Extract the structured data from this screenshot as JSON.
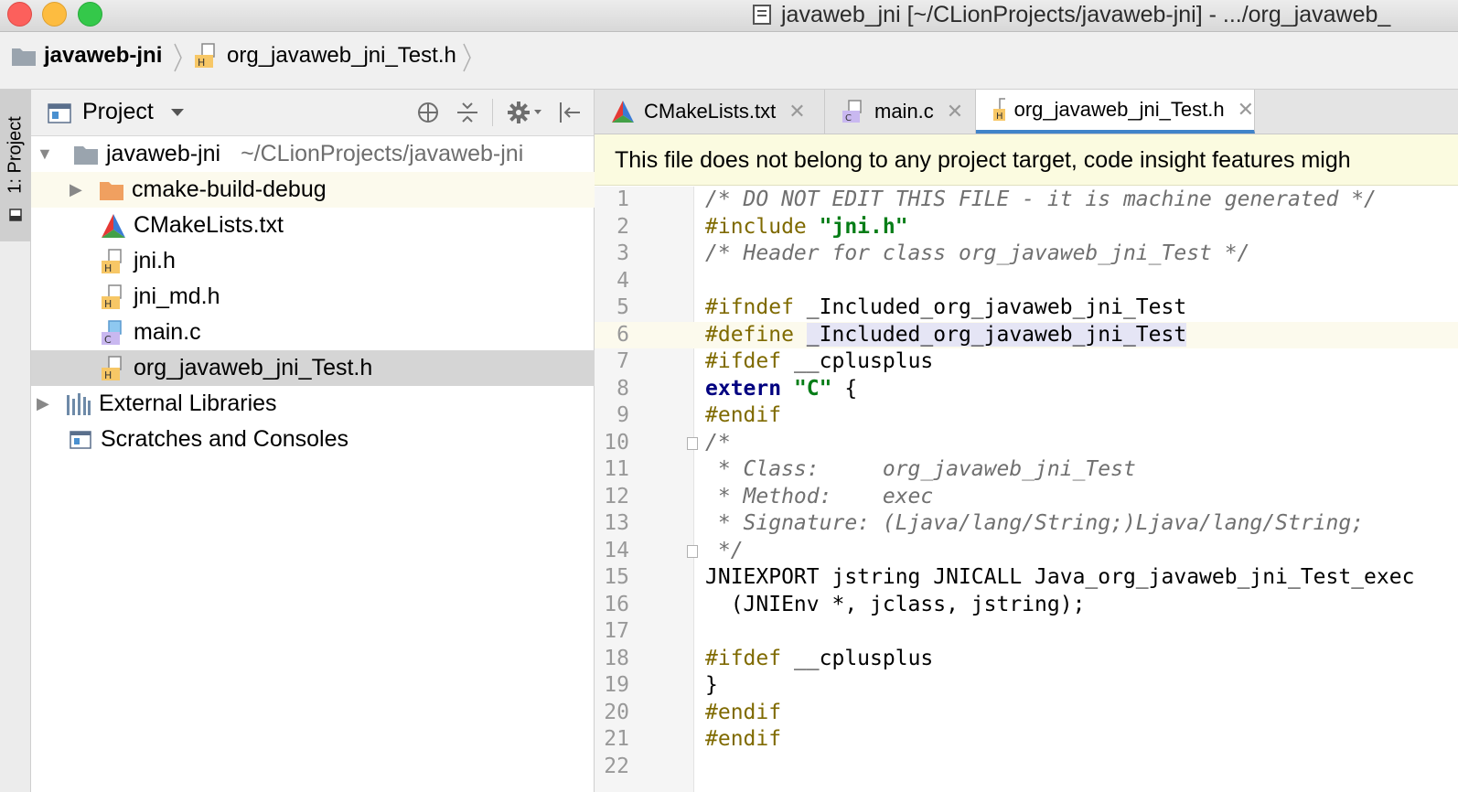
{
  "window": {
    "title": "javaweb_jni [~/CLionProjects/javaweb-jni] - .../org_javaweb_"
  },
  "navbar": {
    "crumbs": [
      "javaweb-jni",
      "org_javaweb_jni_Test.h"
    ]
  },
  "tool_stripe": {
    "label": "1: Project"
  },
  "project_panel": {
    "title": "Project",
    "tree": [
      {
        "label": "javaweb-jni",
        "path": "~/CLionProjects/javaweb-jni"
      },
      {
        "label": "cmake-build-debug"
      },
      {
        "label": "CMakeLists.txt"
      },
      {
        "label": "jni.h"
      },
      {
        "label": "jni_md.h"
      },
      {
        "label": "main.c"
      },
      {
        "label": "org_javaweb_jni_Test.h"
      },
      {
        "label": "External Libraries"
      },
      {
        "label": "Scratches and Consoles"
      }
    ]
  },
  "editor": {
    "tabs": [
      {
        "label": "CMakeLists.txt"
      },
      {
        "label": "main.c"
      },
      {
        "label": "org_javaweb_jni_Test.h",
        "active": true
      }
    ],
    "banner": "This file does not belong to any project target, code insight features migh",
    "lines": [
      "/* DO NOT EDIT THIS FILE - it is machine generated */",
      "#include \"jni.h\"",
      "/* Header for class org_javaweb_jni_Test */",
      "",
      "#ifndef _Included_org_javaweb_jni_Test",
      "#define _Included_org_javaweb_jni_Test",
      "#ifdef __cplusplus",
      "extern \"C\" {",
      "#endif",
      "/*",
      " * Class:     org_javaweb_jni_Test",
      " * Method:    exec",
      " * Signature: (Ljava/lang/String;)Ljava/lang/String;",
      " */",
      "JNIEXPORT jstring JNICALL Java_org_javaweb_jni_Test_exec",
      "  (JNIEnv *, jclass, jstring);",
      "",
      "#ifdef __cplusplus",
      "}",
      "#endif",
      "#endif",
      ""
    ],
    "line_numbers": [
      "1",
      "2",
      "3",
      "4",
      "5",
      "6",
      "7",
      "8",
      "9",
      "10",
      "11",
      "12",
      "13",
      "14",
      "15",
      "16",
      "17",
      "18",
      "19",
      "20",
      "21",
      "22"
    ]
  },
  "colors": {
    "accent": "#4083c9",
    "banner_bg": "#fbfbe0",
    "selection": "#d5d5d5",
    "folder": "#f0a060"
  }
}
